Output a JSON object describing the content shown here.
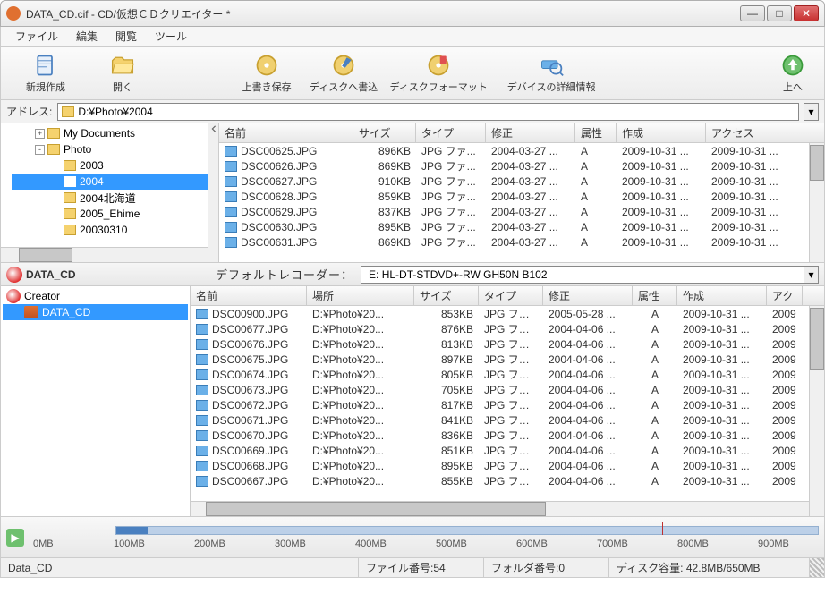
{
  "window": {
    "title": "DATA_CD.cif - CD/仮想ＣＤクリエイター *"
  },
  "menu": {
    "file": "ファイル",
    "edit": "編集",
    "view": "閲覧",
    "tool": "ツール"
  },
  "toolbar": {
    "new": "新規作成",
    "open": "開く",
    "save": "上書き保存",
    "write": "ディスクへ書込",
    "format": "ディスクフォーマット",
    "devinfo": "デバイスの詳細情報",
    "up": "上へ"
  },
  "address": {
    "label": "アドレス:",
    "value": "D:¥Photo¥2004"
  },
  "tree": {
    "items": [
      {
        "depth": 1,
        "expand": "+",
        "label": "My Documents"
      },
      {
        "depth": 1,
        "expand": "-",
        "label": "Photo"
      },
      {
        "depth": 2,
        "expand": "",
        "label": "2003"
      },
      {
        "depth": 2,
        "expand": "",
        "label": "2004",
        "selected": true
      },
      {
        "depth": 2,
        "expand": "",
        "label": "2004北海道"
      },
      {
        "depth": 2,
        "expand": "",
        "label": "2005_Ehime"
      },
      {
        "depth": 2,
        "expand": "",
        "label": "20030310"
      }
    ]
  },
  "upper_cols": {
    "name": "名前",
    "size": "サイズ",
    "type": "タイプ",
    "mod": "修正",
    "attr": "属性",
    "cre": "作成",
    "acc": "アクセス"
  },
  "upper_rows": [
    {
      "name": "DSC00625.JPG",
      "size": "896KB",
      "type": "JPG ファ...",
      "mod": "2004-03-27 ...",
      "attr": "A",
      "cre": "2009-10-31 ...",
      "acc": "2009-10-31 ..."
    },
    {
      "name": "DSC00626.JPG",
      "size": "869KB",
      "type": "JPG ファ...",
      "mod": "2004-03-27 ...",
      "attr": "A",
      "cre": "2009-10-31 ...",
      "acc": "2009-10-31 ..."
    },
    {
      "name": "DSC00627.JPG",
      "size": "910KB",
      "type": "JPG ファ...",
      "mod": "2004-03-27 ...",
      "attr": "A",
      "cre": "2009-10-31 ...",
      "acc": "2009-10-31 ..."
    },
    {
      "name": "DSC00628.JPG",
      "size": "859KB",
      "type": "JPG ファ...",
      "mod": "2004-03-27 ...",
      "attr": "A",
      "cre": "2009-10-31 ...",
      "acc": "2009-10-31 ..."
    },
    {
      "name": "DSC00629.JPG",
      "size": "837KB",
      "type": "JPG ファ...",
      "mod": "2004-03-27 ...",
      "attr": "A",
      "cre": "2009-10-31 ...",
      "acc": "2009-10-31 ..."
    },
    {
      "name": "DSC00630.JPG",
      "size": "895KB",
      "type": "JPG ファ...",
      "mod": "2004-03-27 ...",
      "attr": "A",
      "cre": "2009-10-31 ...",
      "acc": "2009-10-31 ..."
    },
    {
      "name": "DSC00631.JPG",
      "size": "869KB",
      "type": "JPG ファ...",
      "mod": "2004-03-27 ...",
      "attr": "A",
      "cre": "2009-10-31 ...",
      "acc": "2009-10-31 ..."
    }
  ],
  "project": {
    "name": "DATA_CD"
  },
  "recorder": {
    "label": "デフォルトレコーダー：",
    "value": "E: HL-DT-STDVD+-RW GH50N   B102"
  },
  "ltree": {
    "root": "Creator",
    "child": "DATA_CD"
  },
  "lower_cols": {
    "name": "名前",
    "loc": "場所",
    "size": "サイズ",
    "type": "タイプ",
    "mod": "修正",
    "attr": "属性",
    "cre": "作成",
    "acc": "アク"
  },
  "lower_rows": [
    {
      "name": "DSC00900.JPG",
      "loc": "D:¥Photo¥20...",
      "size": "853KB",
      "type": "JPG ファ...",
      "mod": "2005-05-28 ...",
      "attr": "A",
      "cre": "2009-10-31 ...",
      "acc": "2009"
    },
    {
      "name": "DSC00677.JPG",
      "loc": "D:¥Photo¥20...",
      "size": "876KB",
      "type": "JPG ファ...",
      "mod": "2004-04-06 ...",
      "attr": "A",
      "cre": "2009-10-31 ...",
      "acc": "2009"
    },
    {
      "name": "DSC00676.JPG",
      "loc": "D:¥Photo¥20...",
      "size": "813KB",
      "type": "JPG ファ...",
      "mod": "2004-04-06 ...",
      "attr": "A",
      "cre": "2009-10-31 ...",
      "acc": "2009"
    },
    {
      "name": "DSC00675.JPG",
      "loc": "D:¥Photo¥20...",
      "size": "897KB",
      "type": "JPG ファ...",
      "mod": "2004-04-06 ...",
      "attr": "A",
      "cre": "2009-10-31 ...",
      "acc": "2009"
    },
    {
      "name": "DSC00674.JPG",
      "loc": "D:¥Photo¥20...",
      "size": "805KB",
      "type": "JPG ファ...",
      "mod": "2004-04-06 ...",
      "attr": "A",
      "cre": "2009-10-31 ...",
      "acc": "2009"
    },
    {
      "name": "DSC00673.JPG",
      "loc": "D:¥Photo¥20...",
      "size": "705KB",
      "type": "JPG ファ...",
      "mod": "2004-04-06 ...",
      "attr": "A",
      "cre": "2009-10-31 ...",
      "acc": "2009"
    },
    {
      "name": "DSC00672.JPG",
      "loc": "D:¥Photo¥20...",
      "size": "817KB",
      "type": "JPG ファ...",
      "mod": "2004-04-06 ...",
      "attr": "A",
      "cre": "2009-10-31 ...",
      "acc": "2009"
    },
    {
      "name": "DSC00671.JPG",
      "loc": "D:¥Photo¥20...",
      "size": "841KB",
      "type": "JPG ファ...",
      "mod": "2004-04-06 ...",
      "attr": "A",
      "cre": "2009-10-31 ...",
      "acc": "2009"
    },
    {
      "name": "DSC00670.JPG",
      "loc": "D:¥Photo¥20...",
      "size": "836KB",
      "type": "JPG ファ...",
      "mod": "2004-04-06 ...",
      "attr": "A",
      "cre": "2009-10-31 ...",
      "acc": "2009"
    },
    {
      "name": "DSC00669.JPG",
      "loc": "D:¥Photo¥20...",
      "size": "851KB",
      "type": "JPG ファ...",
      "mod": "2004-04-06 ...",
      "attr": "A",
      "cre": "2009-10-31 ...",
      "acc": "2009"
    },
    {
      "name": "DSC00668.JPG",
      "loc": "D:¥Photo¥20...",
      "size": "895KB",
      "type": "JPG ファ...",
      "mod": "2004-04-06 ...",
      "attr": "A",
      "cre": "2009-10-31 ...",
      "acc": "2009"
    },
    {
      "name": "DSC00667.JPG",
      "loc": "D:¥Photo¥20...",
      "size": "855KB",
      "type": "JPG ファ...",
      "mod": "2004-04-06 ...",
      "attr": "A",
      "cre": "2009-10-31 ...",
      "acc": "2009"
    }
  ],
  "ruler": {
    "labels": [
      "0MB",
      "100MB",
      "200MB",
      "300MB",
      "400MB",
      "500MB",
      "600MB",
      "700MB",
      "800MB",
      "900MB"
    ]
  },
  "status": {
    "name": "Data_CD",
    "files_lbl": "ファイル番号:",
    "files_val": "54",
    "folders_lbl": "フォルダ番号:",
    "folders_val": "0",
    "cap_lbl": "ディスク容量:",
    "cap_val": "42.8MB/650MB"
  }
}
